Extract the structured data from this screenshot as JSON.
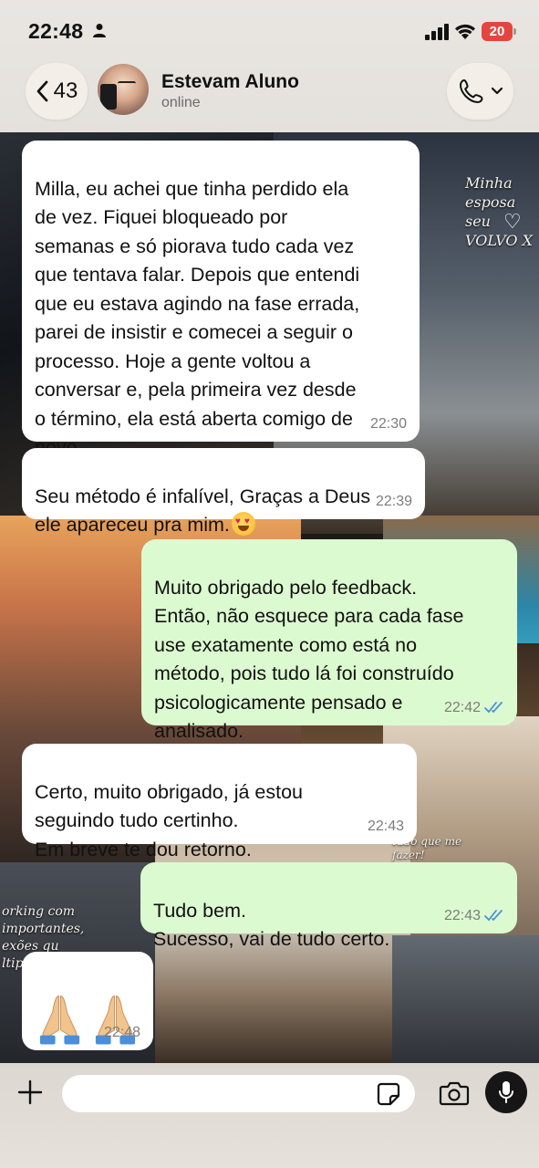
{
  "status_bar": {
    "time": "22:48",
    "battery": "20"
  },
  "header": {
    "back_count": "43",
    "contact_name": "Estevam Aluno",
    "contact_status": "online"
  },
  "messages": [
    {
      "direction": "in",
      "text": "Milla, eu achei que tinha perdido ela\nde vez. Fiquei bloqueado por\nsemanas e só piorava tudo cada vez\nque tentava falar. Depois que entendi\nque eu estava agindo na fase errada,\nparei de insistir e comecei a seguir o\nprocesso. Hoje a gente voltou a\nconversar e, pela primeira vez desde\no término, ela está aberta comigo de\nnovo.",
      "time": "22:30"
    },
    {
      "direction": "in",
      "text": "Seu método é infalível, Graças a Deus\nele apareceu pra mim.",
      "emoji": "heart-eyes",
      "time": "22:39"
    },
    {
      "direction": "out",
      "text": "Muito obrigado pelo feedback.\nEntão, não esquece para cada fase\nuse exatamente como está no\nmétodo, pois tudo lá foi construído\npsicologicamente pensado e\nanalisado.",
      "time": "22:42",
      "read": true
    },
    {
      "direction": "in",
      "text": "Certo, muito obrigado, já estou\nseguindo tudo certinho.\nEm breve te dou retorno.",
      "time": "22:43"
    },
    {
      "direction": "out",
      "text": "Tudo bem.\nSucesso, vai de tudo certo.",
      "time": "22:43",
      "read": true
    },
    {
      "direction": "in",
      "emoji": "folded-hands x2",
      "time": "22:48"
    }
  ],
  "wallpaper_text": {
    "car_caption": "Minha esposa\nseu VOLVO X",
    "left_caption": "orking com\nimportantes,\nexões qu\nltipl",
    "jet_caption": "tudo que me\nfazer!"
  },
  "composer": {
    "placeholder": ""
  },
  "colors": {
    "incoming_bubble": "#ffffff",
    "outgoing_bubble": "#dcfad0",
    "read_ticks": "#4a90d9",
    "battery_low": "#e4463f"
  }
}
